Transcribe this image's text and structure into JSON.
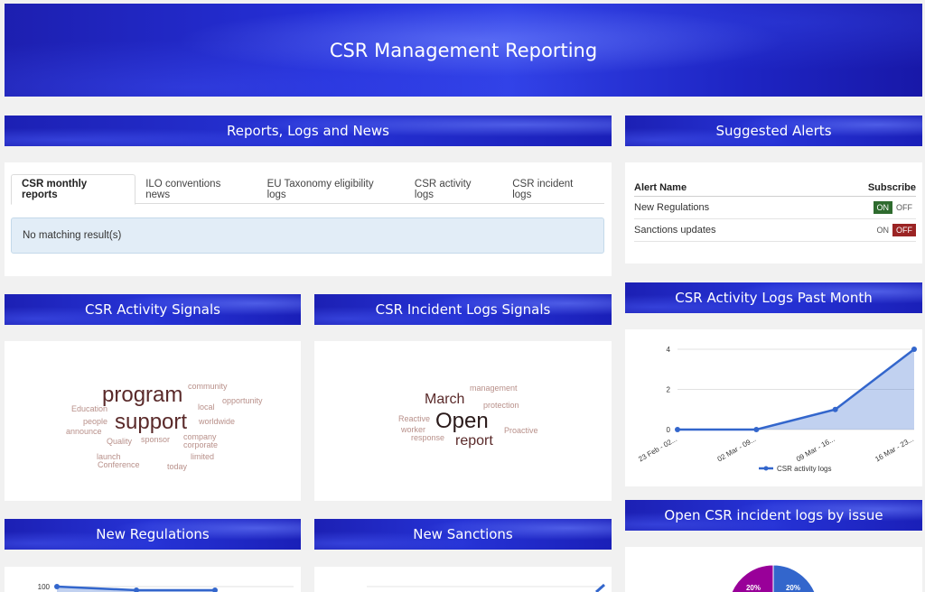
{
  "header": {
    "title": "CSR Management Reporting"
  },
  "sections": {
    "reports": "Reports, Logs and News",
    "alerts": "Suggested Alerts",
    "activity_signals": "CSR Activity Signals",
    "incident_signals": "CSR Incident Logs Signals",
    "activity_logs_chart": "CSR Activity Logs Past Month",
    "new_regulations": "New Regulations",
    "new_sanctions": "New Sanctions",
    "open_incidents": "Open CSR incident logs by issue"
  },
  "tabs": [
    "CSR monthly reports",
    "ILO conventions news",
    "EU Taxonomy eligibility logs",
    "CSR activity logs",
    "CSR incident logs"
  ],
  "no_match_text": "No matching result(s)",
  "alerts_table": {
    "col_name": "Alert Name",
    "col_subscribe": "Subscribe",
    "on_label": "ON",
    "off_label": "OFF",
    "rows": [
      {
        "name": "New Regulations",
        "subscribed": "ON"
      },
      {
        "name": "Sanctions updates",
        "subscribed": "OFF"
      }
    ]
  },
  "activity_cloud": {
    "words": [
      "program",
      "support",
      "community",
      "opportunity",
      "Education",
      "local",
      "people",
      "worldwide",
      "announce",
      "Quality",
      "sponsor",
      "company",
      "corporate",
      "launch",
      "limited",
      "Conference",
      "today"
    ]
  },
  "incident_cloud": {
    "words": [
      "management",
      "March",
      "protection",
      "Reactive",
      "Open",
      "worker",
      "Proactive",
      "response",
      "report"
    ]
  },
  "chart_data": [
    {
      "type": "area",
      "categories": [
        "23 Feb - 02...",
        "02 Mar - 09...",
        "09 Mar - 16...",
        "16 Mar - 23..."
      ],
      "series": [
        {
          "name": "CSR activity logs",
          "values": [
            0,
            0,
            1,
            4
          ]
        }
      ],
      "yticks": [
        0,
        2,
        4
      ],
      "ylim": [
        0,
        4
      ],
      "legend": "bottom",
      "color": "#3366cc"
    },
    {
      "type": "line",
      "yticks": [
        100
      ],
      "series": [
        {
          "values": [
            100,
            98,
            98
          ]
        }
      ],
      "color": "#3366cc"
    },
    {
      "type": "pie",
      "slices": [
        {
          "label": "20%",
          "value": 20,
          "color": "#3366cc"
        },
        {
          "label": "20%",
          "value": 20,
          "color": "#990099"
        }
      ]
    }
  ]
}
